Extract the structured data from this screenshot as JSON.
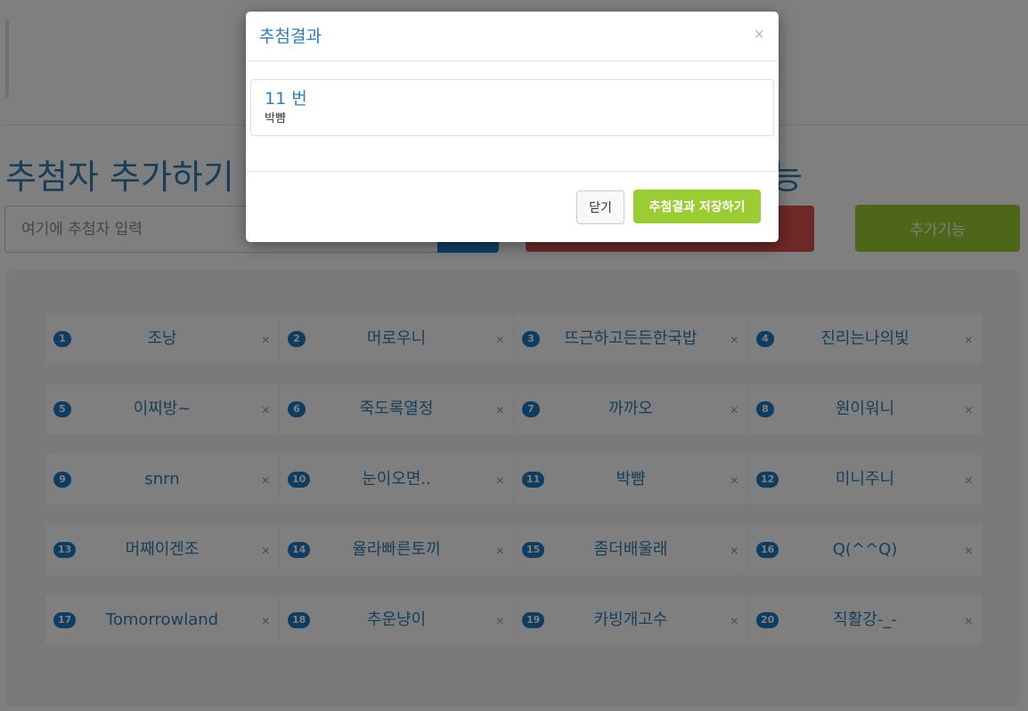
{
  "page": {
    "section_title_left": "추첨자 추가하기",
    "section_title_right": "능",
    "name_input": {
      "placeholder": "여기에 추첨자 입력",
      "value": ""
    },
    "extra_button_label": "추가기능"
  },
  "entries": [
    {
      "num": "1",
      "name": "조낭"
    },
    {
      "num": "2",
      "name": "머로우니"
    },
    {
      "num": "3",
      "name": "뜨근하고든든한국밥"
    },
    {
      "num": "4",
      "name": "진리는나의빛"
    },
    {
      "num": "5",
      "name": "이찌방~"
    },
    {
      "num": "6",
      "name": "죽도록열정"
    },
    {
      "num": "7",
      "name": "까까오"
    },
    {
      "num": "8",
      "name": "원이워니"
    },
    {
      "num": "9",
      "name": "snrn"
    },
    {
      "num": "10",
      "name": "눈이오면.."
    },
    {
      "num": "11",
      "name": "박뺨"
    },
    {
      "num": "12",
      "name": "미니주니"
    },
    {
      "num": "13",
      "name": "머째이겐조"
    },
    {
      "num": "14",
      "name": "율라빠른토끼"
    },
    {
      "num": "15",
      "name": "좀더배울래"
    },
    {
      "num": "16",
      "name": "Q(^^Q)"
    },
    {
      "num": "17",
      "name": "Tomorrowland"
    },
    {
      "num": "18",
      "name": "추운냥이"
    },
    {
      "num": "19",
      "name": "카빙개고수"
    },
    {
      "num": "20",
      "name": "직활강-_-"
    }
  ],
  "remove_glyph": "×",
  "modal": {
    "title": "추첨결과",
    "close_glyph": "×",
    "result_number": "11 번",
    "result_name": "박뺨",
    "close_button_label": "닫기",
    "save_button_label": "추첨결과 저장하기"
  },
  "colors": {
    "accent_blue": "#2f7fb3",
    "badge_blue": "#1f7bc4",
    "draw_red": "#d9534f",
    "save_green": "#9acd32"
  }
}
